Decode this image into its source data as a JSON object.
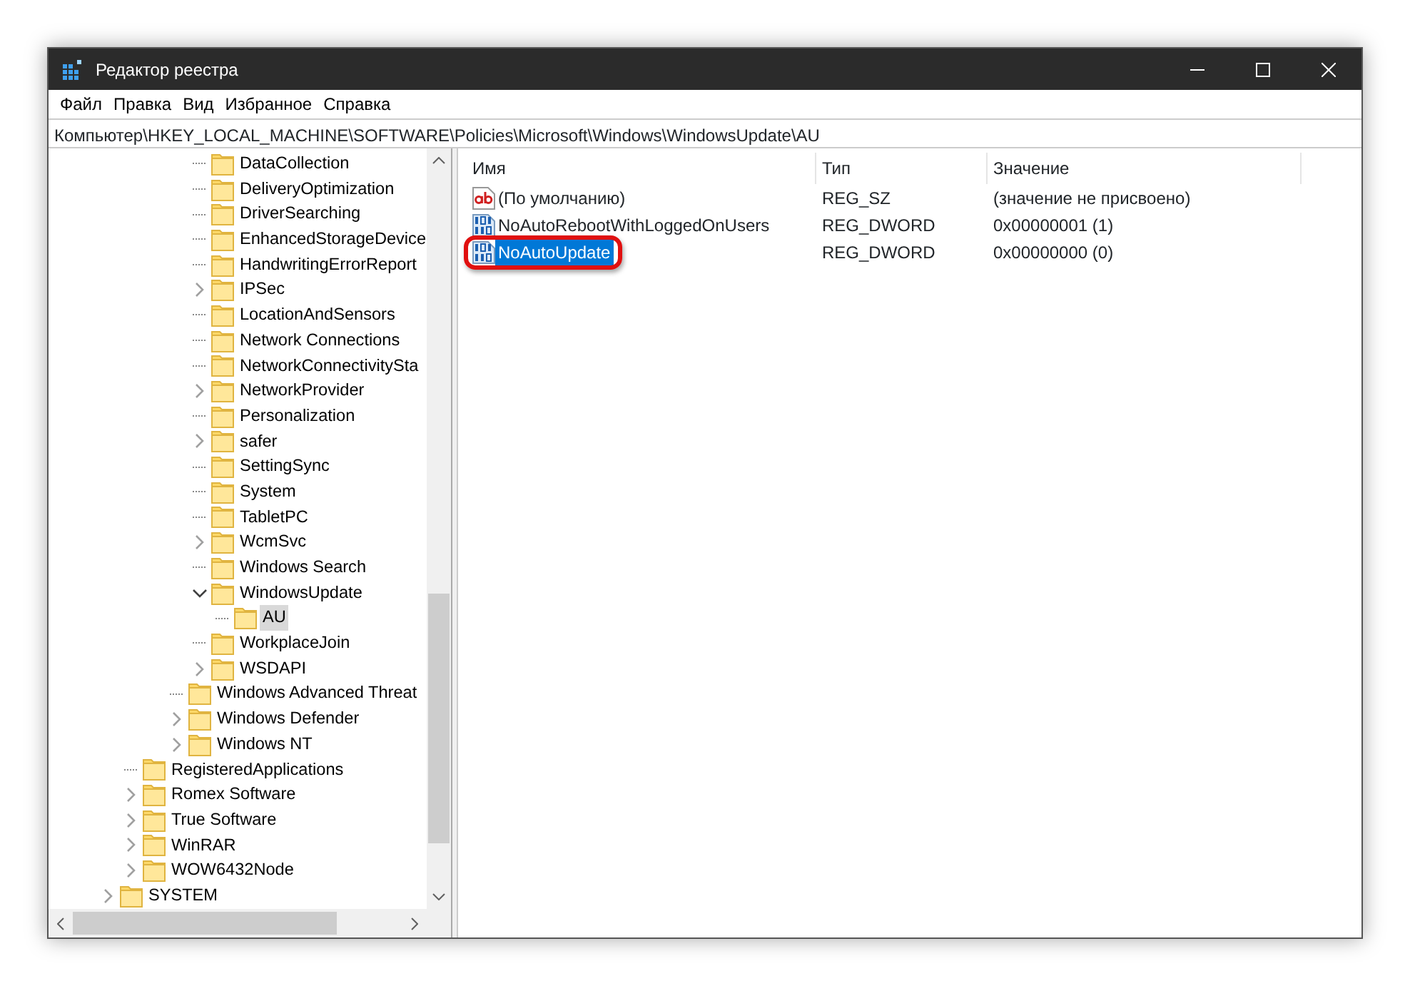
{
  "window": {
    "title": "Редактор реестра"
  },
  "menu": [
    "Файл",
    "Правка",
    "Вид",
    "Избранное",
    "Справка"
  ],
  "address": "Компьютер\\HKEY_LOCAL_MACHINE\\SOFTWARE\\Policies\\Microsoft\\Windows\\WindowsUpdate\\AU",
  "tree": {
    "items": [
      {
        "children": [
          {
            "children": [
              {
                "children": [
                  {
                    "children": [
                      {
                        "label": "DataCollection",
                        "expandable": false,
                        "selected": false
                      },
                      {
                        "label": "DeliveryOptimization",
                        "expandable": false,
                        "selected": false
                      },
                      {
                        "label": "DriverSearching",
                        "expandable": false,
                        "selected": false
                      },
                      {
                        "label": "EnhancedStorageDevice",
                        "expandable": false,
                        "selected": false
                      },
                      {
                        "label": "HandwritingErrorReport",
                        "expandable": false,
                        "selected": false
                      },
                      {
                        "label": "IPSec",
                        "expandable": true,
                        "expanded": false,
                        "selected": false
                      },
                      {
                        "label": "LocationAndSensors",
                        "expandable": false,
                        "selected": false
                      },
                      {
                        "label": "Network Connections",
                        "expandable": false,
                        "selected": false
                      },
                      {
                        "label": "NetworkConnectivitySta",
                        "expandable": false,
                        "selected": false
                      },
                      {
                        "label": "NetworkProvider",
                        "expandable": true,
                        "expanded": false,
                        "selected": false
                      },
                      {
                        "label": "Personalization",
                        "expandable": false,
                        "selected": false
                      },
                      {
                        "label": "safer",
                        "expandable": true,
                        "expanded": false,
                        "selected": false
                      },
                      {
                        "label": "SettingSync",
                        "expandable": false,
                        "selected": false
                      },
                      {
                        "label": "System",
                        "expandable": false,
                        "selected": false
                      },
                      {
                        "label": "TabletPC",
                        "expandable": false,
                        "selected": false
                      },
                      {
                        "label": "WcmSvc",
                        "expandable": true,
                        "expanded": false,
                        "selected": false
                      },
                      {
                        "label": "Windows Search",
                        "expandable": false,
                        "selected": false
                      },
                      {
                        "label": "WindowsUpdate",
                        "expandable": true,
                        "expanded": true,
                        "selected": false,
                        "children": [
                          {
                            "label": "AU",
                            "expandable": false,
                            "selected": true
                          }
                        ]
                      },
                      {
                        "label": "WorkplaceJoin",
                        "expandable": false,
                        "selected": false
                      },
                      {
                        "label": "WSDAPI",
                        "expandable": true,
                        "expanded": false,
                        "selected": false
                      }
                    ]
                  },
                  {
                    "label": "Windows Advanced Threat",
                    "expandable": false,
                    "selected": false
                  },
                  {
                    "label": "Windows Defender",
                    "expandable": true,
                    "expanded": false,
                    "selected": false
                  },
                  {
                    "label": "Windows NT",
                    "expandable": true,
                    "expanded": false,
                    "selected": false
                  }
                ]
              }
            ]
          },
          {
            "label": "RegisteredApplications",
            "expandable": false,
            "selected": false
          },
          {
            "label": "Romex Software",
            "expandable": true,
            "expanded": false,
            "selected": false
          },
          {
            "label": "True Software",
            "expandable": true,
            "expanded": false,
            "selected": false
          },
          {
            "label": "WinRAR",
            "expandable": true,
            "expanded": false,
            "selected": false
          },
          {
            "label": "WOW6432Node",
            "expandable": true,
            "expanded": false,
            "selected": false
          }
        ]
      },
      {
        "label": "SYSTEM",
        "expandable": true,
        "expanded": false,
        "selected": false
      }
    ]
  },
  "values": {
    "columns": [
      "Имя",
      "Тип",
      "Значение"
    ],
    "rows": [
      {
        "kind": "string",
        "name": "(По умолчанию)",
        "type": "REG_SZ",
        "data": "(значение не присвоено)",
        "selected": false,
        "highlighted": false
      },
      {
        "kind": "dword",
        "name": "NoAutoRebootWithLoggedOnUsers",
        "type": "REG_DWORD",
        "data": "0x00000001 (1)",
        "selected": false,
        "highlighted": false
      },
      {
        "kind": "dword",
        "name": "NoAutoUpdate",
        "type": "REG_DWORD",
        "data": "0x00000000 (0)",
        "selected": true,
        "highlighted": true
      }
    ]
  }
}
